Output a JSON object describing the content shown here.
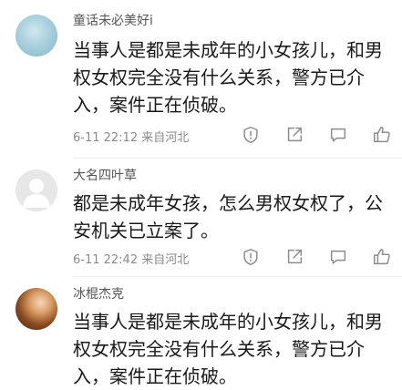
{
  "comments": [
    {
      "username": "童话未必美好i",
      "text": "当事人是都是未成年的小女孩儿，和男权女权完全没有什么关系，警方已介入，案件正在侦破。",
      "time": "6-11 22:12",
      "location": "来自河北",
      "icons": [
        "shield-icon",
        "share-icon",
        "comment-icon",
        "like-icon"
      ]
    },
    {
      "username": "大名四叶草",
      "text": "都是未成年女孩，怎么男权女权了，公安机关已立案了。",
      "time": "6-11 22:42",
      "location": "来自河北",
      "icons": [
        "shield-icon",
        "share-icon",
        "comment-icon",
        "like-icon"
      ]
    },
    {
      "username": "冰棍杰克",
      "text": "当事人是都是未成年的小女孩儿，和男权女权完全没有什么关系，警方已介入，案件正在侦破。"
    }
  ]
}
